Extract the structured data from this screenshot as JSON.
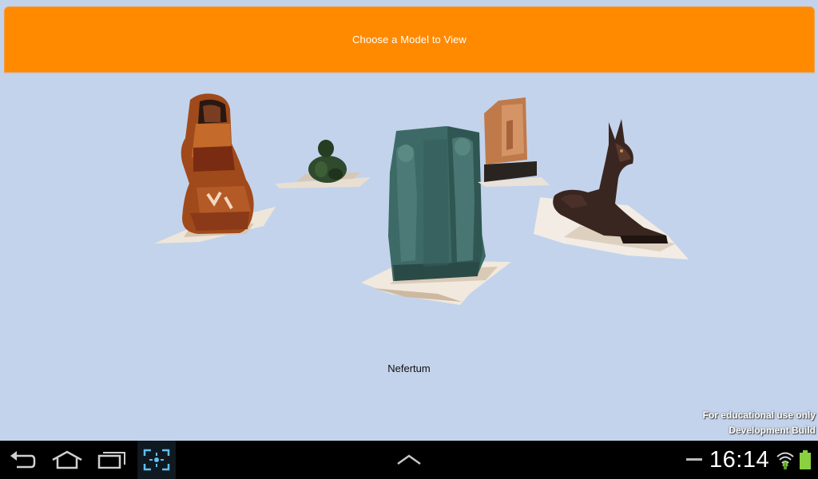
{
  "header": {
    "button_label": "Choose a Model to View"
  },
  "scene": {
    "models": [
      "sarcophagus-figure",
      "small-green-figure",
      "nefertum-statue",
      "stele",
      "anubis-jackal"
    ],
    "selected_caption": "Nefertum"
  },
  "watermark": {
    "line1": "For educational use only",
    "line2": "Development Build"
  },
  "system_bar": {
    "icons": [
      "back-icon",
      "home-icon",
      "recent-apps-icon",
      "screenshot-icon",
      "up-chevron-icon",
      "dash-icon",
      "wifi-icon",
      "battery-icon"
    ],
    "time": "16:14"
  }
}
